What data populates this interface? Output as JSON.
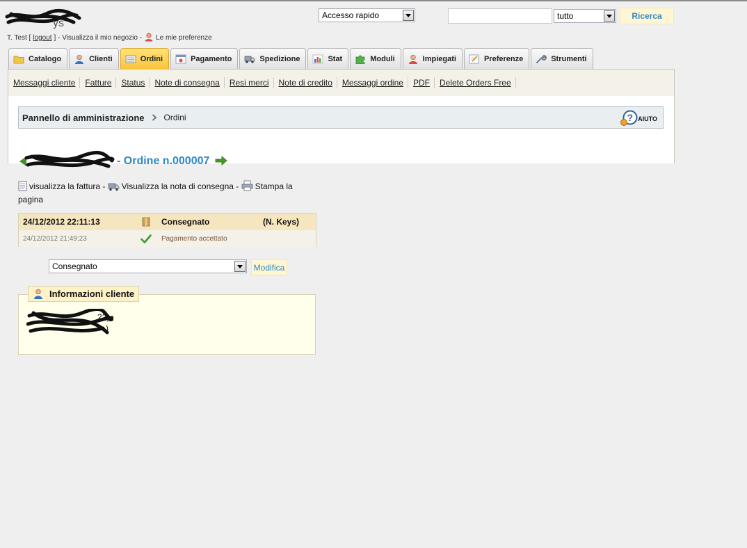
{
  "header": {
    "quick_access": "Accesso rapido",
    "search_value": "",
    "search_scope": "tutto",
    "search_button": "Ricerca"
  },
  "user_line": {
    "name": "T. Test [",
    "logout": "logout",
    "after_logout": "] - Visualizza il mio negozio -",
    "preferences": "Le mie preferenze"
  },
  "tabs": [
    {
      "label": "Catalogo",
      "icon": "folder-icon"
    },
    {
      "label": "Clienti",
      "icon": "customer-icon"
    },
    {
      "label": "Ordini",
      "icon": "cart-icon",
      "active": true
    },
    {
      "label": "Pagamento",
      "icon": "payment-icon"
    },
    {
      "label": "Spedizione",
      "icon": "truck-icon"
    },
    {
      "label": "Stat",
      "icon": "stats-icon"
    },
    {
      "label": "Moduli",
      "icon": "puzzle-icon"
    },
    {
      "label": "Impiegati",
      "icon": "employee-icon"
    },
    {
      "label": "Preferenze",
      "icon": "preferences-icon"
    },
    {
      "label": "Strumenti",
      "icon": "wrench-icon"
    }
  ],
  "submenu": [
    "Messaggi cliente",
    "Fatture",
    "Status",
    "Note di consegna",
    "Resi merci",
    "Note di credito",
    "Messaggi ordine",
    "PDF",
    "Delete Orders Free"
  ],
  "breadcrumb": {
    "home": "Pannello di amministrazione",
    "current": "Ordini",
    "help": "AIUTO"
  },
  "order": {
    "title": "- Ordine n.000007"
  },
  "actions": {
    "invoice": "visualizza la fattura -",
    "delivery": "Visualizza la nota di consegna -",
    "print": "Stampa la pagina"
  },
  "history": [
    {
      "date": "24/12/2012 22:11:13",
      "status": "Consegnato",
      "employee": "(N. Keys)"
    },
    {
      "date": "24/12/2012 21:49:23",
      "status": "Pagamento accettato",
      "employee": ""
    }
  ],
  "status_form": {
    "selected": "Consegnato",
    "button": "Modifica"
  },
  "customer": {
    "legend": "Informazioni cliente",
    "line1_tail": "22)",
    "line2_tail": ")"
  },
  "colors": {
    "accent_blue": "#2e88c7",
    "active_tab": "#fbc43a",
    "button_bg": "#fff6d3"
  }
}
